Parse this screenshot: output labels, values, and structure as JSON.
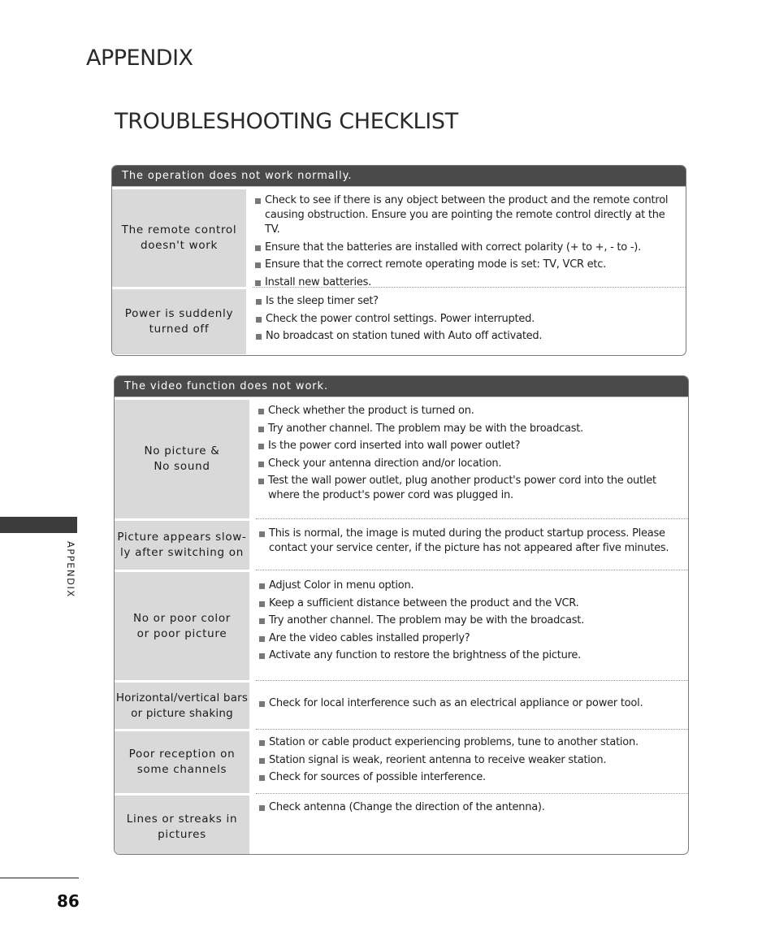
{
  "header": {
    "section": "APPENDIX",
    "title": "TROUBLESHOOTING CHECKLIST"
  },
  "side_tab": {
    "label": "APPENDIX"
  },
  "footer": {
    "page_number": "86"
  },
  "sections": [
    {
      "heading": "The operation does not work normally.",
      "rows": [
        {
          "label": "The remote control doesn't work",
          "items": [
            "Check to see if there is any object between the product and the remote control causing obstruction. Ensure you are pointing the remote control directly at the TV.",
            "Ensure that the batteries are installed with correct polarity (+ to +, - to -).",
            "Ensure that the correct remote operating mode is set: TV, VCR etc.",
            "Install new batteries."
          ]
        },
        {
          "label": "Power is suddenly turned off",
          "items": [
            "Is the sleep timer set?",
            "Check the power control settings. Power interrupted.",
            "No broadcast on station tuned with Auto off activated."
          ]
        }
      ]
    },
    {
      "heading": "The video function does not work.",
      "rows": [
        {
          "label": "No picture & No sound",
          "items": [
            "Check whether the product is turned on.",
            "Try another channel. The problem may be with the broadcast.",
            "Is the power cord inserted into wall power outlet?",
            "Check your antenna direction and/or location.",
            "Test the wall power outlet, plug another product's power cord into the outlet where the product's power cord was plugged in."
          ]
        },
        {
          "label": "Picture appears slow-ly after switching on",
          "items": [
            "This is normal, the image is muted during the product startup process. Please contact your service center, if the picture has not appeared after five minutes."
          ]
        },
        {
          "label": "No or poor color or poor picture",
          "items": [
            "Adjust Color in menu option.",
            "Keep a sufficient distance between the product and the VCR.",
            "Try another channel. The problem may be with the broadcast.",
            "Are the video cables installed properly?",
            "Activate any function to restore the brightness of the picture."
          ]
        },
        {
          "label": "Horizontal/vertical bars or picture shaking",
          "items": [
            "Check for local interference such as an electrical appliance or power tool."
          ]
        },
        {
          "label": "Poor reception on some channels",
          "items": [
            "Station or cable product experiencing problems, tune to another station.",
            "Station signal is weak, reorient antenna to receive weaker station.",
            "Check for sources of possible interference."
          ]
        },
        {
          "label": "Lines or streaks in pictures",
          "items": [
            "Check antenna (Change the direction of the antenna)."
          ]
        }
      ]
    }
  ]
}
